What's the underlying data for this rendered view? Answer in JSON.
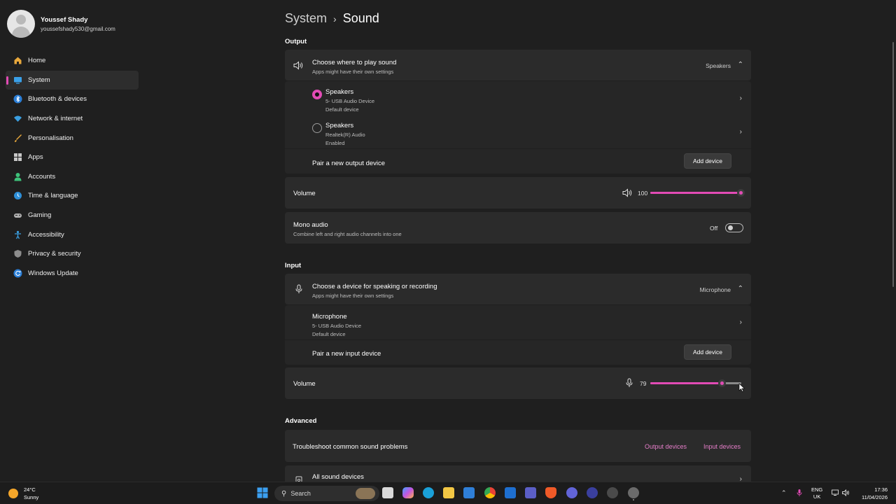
{
  "profile": {
    "name": "Youssef Shady",
    "email": "youssefshady530@gmail.com"
  },
  "nav": {
    "items": [
      {
        "label": "Home",
        "icon": "home-icon"
      },
      {
        "label": "System",
        "icon": "monitor-icon"
      },
      {
        "label": "Bluetooth & devices",
        "icon": "bluetooth-icon"
      },
      {
        "label": "Network & internet",
        "icon": "wifi-icon"
      },
      {
        "label": "Personalisation",
        "icon": "brush-icon"
      },
      {
        "label": "Apps",
        "icon": "apps-icon"
      },
      {
        "label": "Accounts",
        "icon": "person-icon"
      },
      {
        "label": "Time & language",
        "icon": "globe-clock-icon"
      },
      {
        "label": "Gaming",
        "icon": "gamepad-icon"
      },
      {
        "label": "Accessibility",
        "icon": "accessibility-icon"
      },
      {
        "label": "Privacy & security",
        "icon": "shield-icon"
      },
      {
        "label": "Windows Update",
        "icon": "update-icon"
      }
    ],
    "active_index": 1
  },
  "breadcrumb": {
    "parent": "System",
    "separator": "›",
    "current": "Sound"
  },
  "output": {
    "section_title": "Output",
    "choose": {
      "title": "Choose where to play sound",
      "subtitle": "Apps might have their own settings",
      "value": "Speakers"
    },
    "devices": [
      {
        "name": "Speakers",
        "line1": "5- USB Audio Device",
        "line2": "Default device",
        "selected": true
      },
      {
        "name": "Speakers",
        "line1": "Realtek(R) Audio",
        "line2": "Enabled",
        "selected": false
      }
    ],
    "pair": {
      "label": "Pair a new output device",
      "button": "Add device"
    },
    "volume": {
      "label": "Volume",
      "value": "100",
      "level": 1.0
    },
    "mono": {
      "title": "Mono audio",
      "subtitle": "Combine left and right audio channels into one",
      "state": "Off"
    }
  },
  "input": {
    "section_title": "Input",
    "choose": {
      "title": "Choose a device for speaking or recording",
      "subtitle": "Apps might have their own settings",
      "value": "Microphone"
    },
    "device": {
      "name": "Microphone",
      "line1": "5- USB Audio Device",
      "line2": "Default device"
    },
    "pair": {
      "label": "Pair a new input device",
      "button": "Add device"
    },
    "volume": {
      "label": "Volume",
      "value": "79",
      "level": 0.79
    }
  },
  "advanced": {
    "section_title": "Advanced",
    "troubleshoot": {
      "label": "Troubleshoot common sound problems",
      "output_link": "Output devices",
      "input_link": "Input devices"
    },
    "all_devices": {
      "label": "All sound devices"
    }
  },
  "taskbar": {
    "weather": {
      "temp": "24°C",
      "condition": "Sunny"
    },
    "search_placeholder": "Search",
    "lang": {
      "line1": "ENG",
      "line2": "UK"
    },
    "clock": {
      "time": "17:36",
      "date": "11/04/2026"
    }
  },
  "colors": {
    "accent": "#e24bb5",
    "link": "#e57ec9",
    "background": "#1f1f1f",
    "card": "#2b2b2b"
  }
}
